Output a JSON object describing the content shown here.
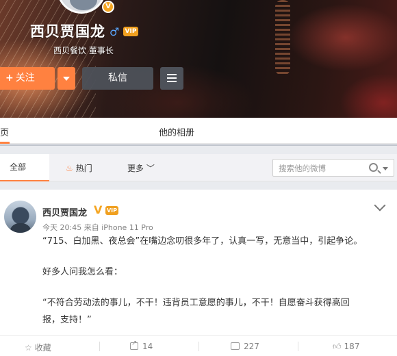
{
  "profile": {
    "name": "西贝贾国龙",
    "title": "西贝餐饮 董事长",
    "follow_label": "关注",
    "message_label": "私信"
  },
  "tabs": {
    "home_partial": "页",
    "album": "他的相册"
  },
  "filter": {
    "all": "全部",
    "hot": "热门",
    "more": "更多",
    "search_placeholder": "搜索他的微博"
  },
  "post": {
    "author": "西贝贾国龙",
    "meta": "今天 20:45 来自 iPhone 11 Pro",
    "lines": [
      "“715、白加黑、夜总会”在嘴边念叨很多年了，认真一写，无意当中，引起争论。",
      "好多人问我怎么看：",
      "“不符合劳动法的事儿，不干！违背员工意愿的事儿，不干！自愿奋斗获得高回",
      "报，支持！”"
    ]
  },
  "actions": {
    "favorite": "收藏",
    "forward": "14",
    "comment": "227",
    "like": "187"
  },
  "colors": {
    "accent": "#ff8140",
    "verified": "#f5a623",
    "dark_button": "#4d5159"
  }
}
